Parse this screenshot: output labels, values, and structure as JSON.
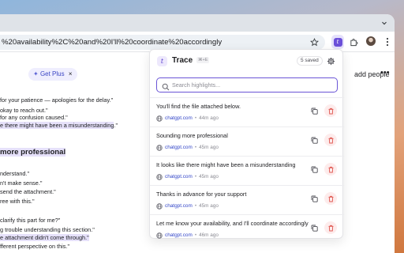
{
  "browser": {
    "url_text": "%20availability%2C%20and%20I'll%20coordinate%20accordingly",
    "extension_name": "Trace"
  },
  "page": {
    "get_plus_label": "Get Plus",
    "add_people_label": "add people",
    "more_label": "•••",
    "lines_top": [
      {
        "text": "for your patience — apologies for the delay.\"",
        "highlight": false
      },
      {
        "text": "okay to reach out.\"",
        "highlight": false
      },
      {
        "text": "for any confusion caused.\"",
        "highlight": false
      },
      {
        "text": "e there might have been a misunderstanding",
        "tail": ".\"",
        "highlight": true
      }
    ],
    "section_heading": "more professional",
    "lines_bottom": [
      {
        "text": "nderstand.\"",
        "highlight": false
      },
      {
        "text": "n't make sense.\"",
        "highlight": false
      },
      {
        "text": "send the attachment.\"",
        "highlight": false
      },
      {
        "text": "ree with this.\"",
        "highlight": false
      },
      {
        "text": "clarify this part for me?\"",
        "highlight": false
      },
      {
        "text": "g trouble understanding this section.\"",
        "highlight": false
      },
      {
        "text": "e attachment didn't come through.\"",
        "highlight": true
      },
      {
        "text": "fferent perspective on this.\"",
        "highlight": false
      }
    ]
  },
  "panel": {
    "logo_glyph": "t",
    "title": "Trace",
    "shortcut": "⌘+E",
    "saved_badge": "5 saved",
    "search_placeholder": "Search highlights...",
    "search_value": "",
    "items": [
      {
        "text": "You'll find the file attached below.",
        "domain": "chatgpt.com",
        "ago": "44m ago"
      },
      {
        "text": "Sounding more professional",
        "domain": "chatgpt.com",
        "ago": "45m ago"
      },
      {
        "text": "It looks like there might have been a misunderstanding",
        "domain": "chatgpt.com",
        "ago": "45m ago"
      },
      {
        "text": "Thanks in advance for your support",
        "domain": "chatgpt.com",
        "ago": "45m ago"
      },
      {
        "text": "Let me know your availability, and I'll coordinate accordingly",
        "domain": "chatgpt.com",
        "ago": "46m ago"
      }
    ]
  },
  "colors": {
    "accent": "#6a55d6",
    "link": "#3447c9",
    "delete": "#e0564f",
    "highlight": "#e6e1fa"
  },
  "icons": {
    "tab_overflow": "chevron-down-icon",
    "bookmark": "star-icon",
    "extension": "trace-logo-icon",
    "puzzle": "puzzle-icon",
    "menu": "kebab-icon",
    "settings": "gear-icon",
    "search": "search-icon",
    "site": "globe-icon",
    "copy": "copy-icon",
    "delete": "trash-icon"
  }
}
